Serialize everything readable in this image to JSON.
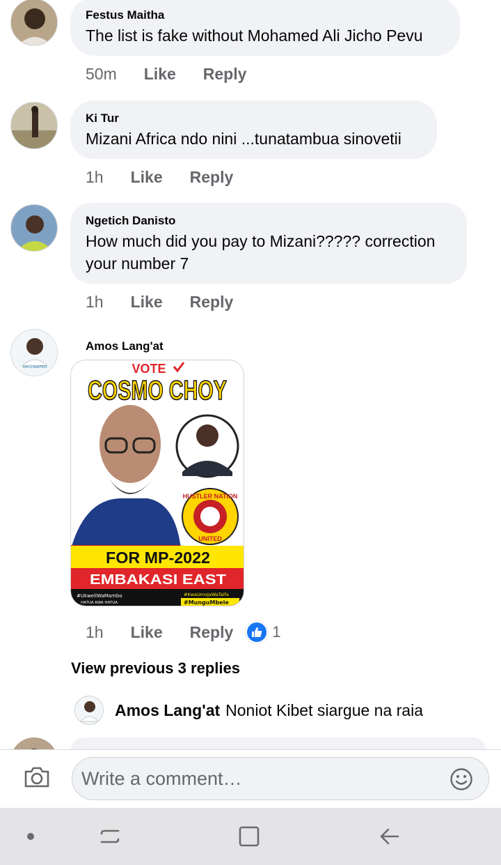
{
  "comments": [
    {
      "author": "Festus Maitha",
      "text": "The list is fake without Mohamed Ali Jicho Pevu",
      "time": "50m",
      "like": "Like",
      "reply": "Reply"
    },
    {
      "author": "Ki Tur",
      "text": "Mizani Africa ndo nini ...tunatambua sinovetii",
      "time": "1h",
      "like": "Like",
      "reply": "Reply"
    },
    {
      "author": "Ngetich Danisto",
      "text": "How much did you pay to Mizani?????  correction your number 7",
      "time": "1h",
      "like": "Like",
      "reply": "Reply"
    },
    {
      "author": "Amos Lang'at",
      "time": "1h",
      "like": "Like",
      "reply": "Reply",
      "reaction_count": "1",
      "reaction_icon": "thumbs-up-icon"
    }
  ],
  "poster": {
    "vote": "VOTE",
    "name": "COSMO CHOY",
    "for": "FOR MP-2022",
    "constituency": "EMBAKASI EAST",
    "badge_line1": "HUSTLER NATION",
    "badge_line2": "UNITED",
    "tag_left1": "#UkweliWaMambo",
    "tag_left2": "HATUA KWA HATUA",
    "tag_right1": "#KwaUmojaWaTaifa",
    "tag_right2": "#MunguMbele",
    "avatar_tag": "VACCINATED"
  },
  "thread": {
    "view_previous": "View previous 3 replies",
    "reply_author": "Amos Lang'at",
    "reply_text": "Noniot Kibet siargue na raia"
  },
  "composer": {
    "placeholder": "Write a comment…",
    "camera_icon": "camera-icon",
    "emoji_icon": "emoji-icon"
  },
  "navbar": [
    "dot-icon",
    "recent-apps-icon",
    "home-icon",
    "back-icon"
  ],
  "colors": {
    "bubble": "#f0f2f5",
    "meta": "#65676b",
    "like_blue": "#1877f2",
    "navbar": "#e4e4e6"
  }
}
